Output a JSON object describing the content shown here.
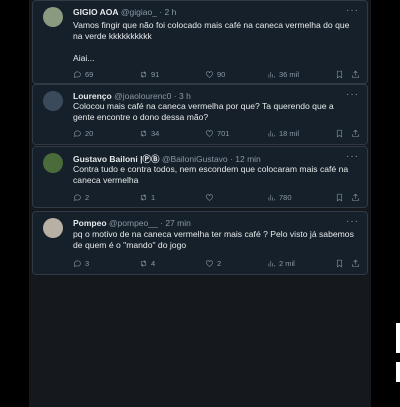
{
  "tweets": [
    {
      "name": "GIGIO AOA",
      "handle": "@gigiao_",
      "time": "2 h",
      "text": "Vamos fingir que não foi colocado mais café na caneca vermelha do que na verde kkkkkkkkkk",
      "text2": "Aiai...",
      "replies": "69",
      "retweets": "91",
      "likes": "90",
      "views": "36 mil",
      "avatar_color": "#8a9a80"
    },
    {
      "name": "Lourenço",
      "handle": "@joaolourenc0",
      "time": "3 h",
      "text": "Colocou mais café na caneca vermelha por que? Ta querendo que a gente encontre o dono dessa mão?",
      "replies": "20",
      "retweets": "34",
      "likes": "701",
      "views": "18 mil",
      "avatar_color": "#3b4a5a"
    },
    {
      "name": "Gustavo Bailoni",
      "name_badge": "|ⓅⒷ",
      "handle": "@BailoniGustavo",
      "time": "12 min",
      "text": "Contra tudo e contra todos, nem escondem que colocaram mais café na caneca vermelha",
      "replies": "2",
      "retweets": "1",
      "likes": "",
      "views": "780",
      "avatar_color": "#4a6b3a"
    },
    {
      "name": "Pompeo",
      "handle": "@pompeo__",
      "time": "27 min",
      "text": "pq o motivo de na caneca vermelha ter mais café ? Pelo visto já sabemos de quem é o \"mando\" do jogo",
      "replies": "3",
      "retweets": "4",
      "likes": "2",
      "views": "2 mil",
      "avatar_color": "#b8b0a4"
    }
  ],
  "icons": {
    "reply": "reply-icon",
    "retweet": "retweet-icon",
    "like": "heart-icon",
    "views": "views-icon",
    "bookmark": "bookmark-icon",
    "share": "share-icon",
    "more": "more-icon"
  }
}
